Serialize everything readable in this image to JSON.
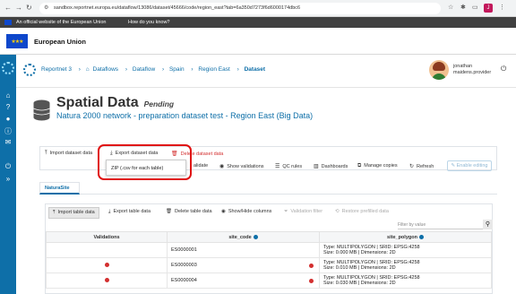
{
  "browser": {
    "url": "sandbox.reportnet.europa.eu/dataflow/13086/dataset/45666/code/region_east?tab=6a350d7273f6d6000174dbc6",
    "profile_initial": "J"
  },
  "eu_banner": {
    "official_text": "An official website of the European Union",
    "how_know": "How do you know?"
  },
  "eu_header": {
    "title": "European Union"
  },
  "breadcrumbs": [
    {
      "label": "Reportnet 3"
    },
    {
      "label": "Dataflows"
    },
    {
      "label": "Dataflow"
    },
    {
      "label": "Spain"
    },
    {
      "label": "Region East"
    },
    {
      "label": "Dataset"
    }
  ],
  "user": {
    "line1": "jonathan",
    "line2": "maidens.provider"
  },
  "page": {
    "title": "Spatial Data",
    "status": "Pending",
    "subtitle": "Natura 2000 network - preparation dataset test - Region East (Big Data)"
  },
  "toolbar": {
    "import": "Import dataset data",
    "export": "Export dataset data",
    "delete": "Delete dataset data",
    "validate_partial": "alidate",
    "show_validations": "Show validations",
    "qc_rules": "QC rules",
    "dashboards": "Dashboards",
    "manage_copies": "Manage copies",
    "refresh": "Refresh",
    "enable_editing": "Enable editing"
  },
  "export_menu": {
    "item": "ZIP (.csv for each table)"
  },
  "tabs": [
    {
      "label": "NaturaSite"
    }
  ],
  "table_toolbar": {
    "import": "Import table data",
    "export": "Export table data",
    "delete": "Delete table data",
    "show_hide": "Show/Hide columns",
    "validation_filter": "Validation filter",
    "restore": "Restore prefilled data",
    "filter_placeholder": "Filter by value"
  },
  "table": {
    "headers": [
      "Validations",
      "site_code",
      "site_polygon"
    ],
    "rows": [
      {
        "error": false,
        "code": "ES0000001",
        "code_error": false,
        "poly1": "Type: MULTIPOLYGON | SRID: EPSG:4258",
        "poly2": "Size: 0.000 MB | Dimensions: 2D"
      },
      {
        "error": true,
        "code": "ES0000003",
        "code_error": true,
        "poly1": "Type: MULTIPOLYGON | SRID: EPSG:4258",
        "poly2": "Size: 0.010 MB | Dimensions: 2D"
      },
      {
        "error": true,
        "code": "ES0000004",
        "code_error": true,
        "poly1": "Type: MULTIPOLYGON | SRID: EPSG:4258",
        "poly2": "Size: 0.030 MB | Dimensions: 2D"
      }
    ]
  },
  "colors": {
    "brand": "#0e6fa8",
    "error": "#d32f2f",
    "highlight": "#e01010",
    "eu_blue": "#0e47cb"
  }
}
